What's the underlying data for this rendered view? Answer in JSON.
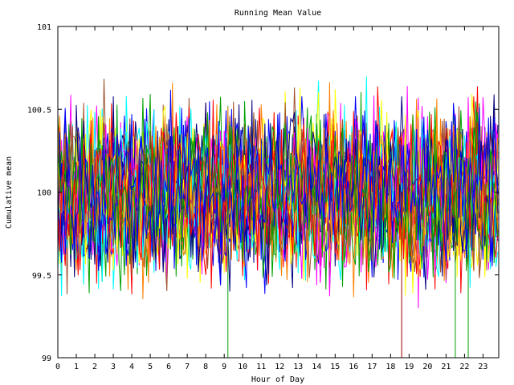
{
  "chart_data": {
    "type": "line",
    "title": "Running Mean Value",
    "xlabel": "Hour of Day",
    "ylabel": "Cumulative mean",
    "xlim": [
      0,
      23.85
    ],
    "ylim": [
      99,
      101
    ],
    "x_ticks": [
      0,
      1,
      2,
      3,
      4,
      5,
      6,
      7,
      8,
      9,
      10,
      11,
      12,
      13,
      14,
      15,
      16,
      17,
      18,
      19,
      20,
      21,
      22,
      23
    ],
    "y_ticks": [
      {
        "value": 99,
        "label": "99"
      },
      {
        "value": 99.5,
        "label": "99.5"
      },
      {
        "value": 100,
        "label": "100"
      },
      {
        "value": 100.5,
        "label": "100.5"
      },
      {
        "value": 101,
        "label": "101"
      }
    ],
    "grid": false,
    "legend": "none",
    "sample_step_hours": 0.1,
    "series_colors": [
      "#ff0000",
      "#00a000",
      "#0000ff",
      "#ff00ff",
      "#00ffff",
      "#ffff00",
      "#a0522d",
      "#000080",
      "#ff8000"
    ],
    "value_range_typical": [
      99.3,
      100.7
    ],
    "dips_to_axis_minimum": [
      {
        "x": 9.2,
        "color": "#00a000"
      },
      {
        "x": 18.6,
        "color": "#a00000"
      },
      {
        "x": 21.5,
        "color": "#00a000"
      },
      {
        "x": 22.2,
        "color": "#00a000"
      }
    ],
    "series_count": 30
  }
}
